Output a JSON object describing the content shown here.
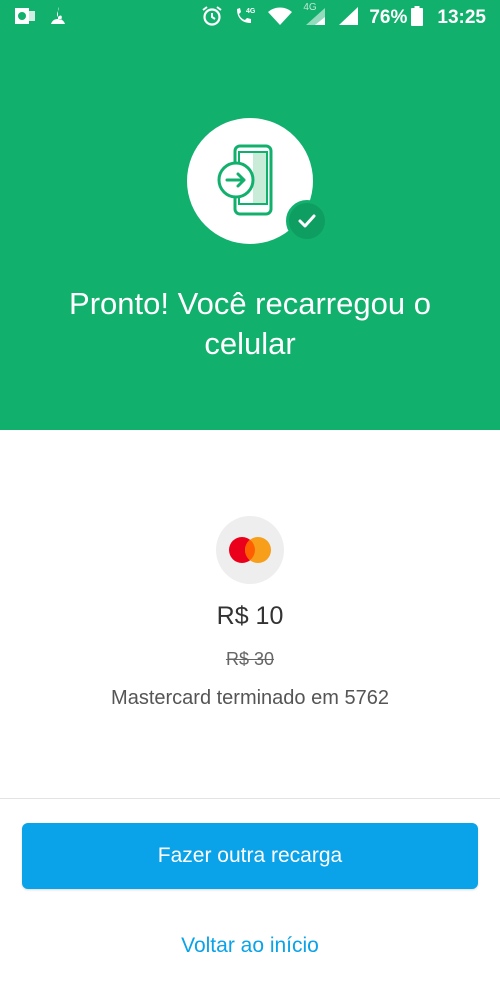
{
  "status_bar": {
    "battery": "76%",
    "time": "13:25",
    "network_label": "4G",
    "icons": [
      "outlook-icon",
      "santander-icon",
      "alarm-icon",
      "volte-call-icon",
      "wifi-icon",
      "signal-icon",
      "signal-icon",
      "battery-icon"
    ]
  },
  "hero": {
    "title": "Pronto! Você recarregou o celular",
    "background_color": "#12b06d",
    "icon": "phone-recharge-icon",
    "badge_icon": "check-icon"
  },
  "payment": {
    "card_brand_icon": "mastercard-icon",
    "amount": "R$ 10",
    "old_amount": "R$ 30",
    "card_description": "Mastercard terminado em 5762"
  },
  "actions": {
    "primary_label": "Fazer outra recarga",
    "secondary_label": "Voltar ao início",
    "accent_color": "#0aa2e8"
  }
}
